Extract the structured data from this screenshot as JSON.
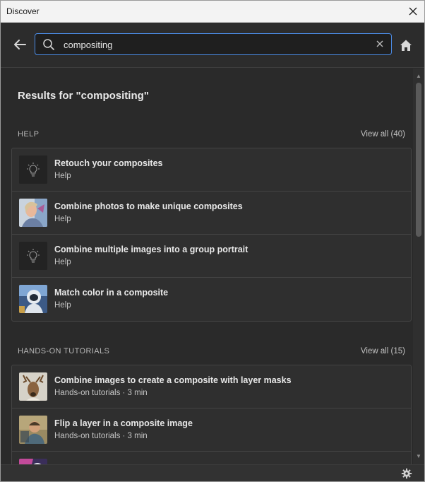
{
  "window": {
    "title": "Discover"
  },
  "search": {
    "value": "compositing",
    "placeholder": ""
  },
  "results": {
    "heading": "Results for \"compositing\""
  },
  "help": {
    "label": "HELP",
    "view_all": "View all (40)",
    "items": [
      {
        "title": "Retouch your composites",
        "sub": "Help",
        "icon": "lightbulb-icon"
      },
      {
        "title": "Combine photos to make unique composites",
        "sub": "Help",
        "icon": "photo-thumbnail"
      },
      {
        "title": "Combine multiple images into a group portrait",
        "sub": "Help",
        "icon": "lightbulb-icon"
      },
      {
        "title": "Match color in a composite",
        "sub": "Help",
        "icon": "photo-thumbnail"
      }
    ]
  },
  "tutorials": {
    "label": "HANDS-ON TUTORIALS",
    "view_all": "View all (15)",
    "items": [
      {
        "title": "Combine images to create a composite with layer masks",
        "sub": "Hands-on tutorials  ·  3 min",
        "icon": "photo-thumbnail"
      },
      {
        "title": "Flip a layer in a composite image",
        "sub": "Hands-on tutorials  ·  3 min",
        "icon": "photo-thumbnail"
      },
      {
        "title": "",
        "sub": "",
        "icon": "photo-thumbnail"
      }
    ]
  },
  "colors": {
    "accent": "#4b8ce6",
    "panel": "#2a2a2a",
    "card": "#2f2f2f"
  }
}
